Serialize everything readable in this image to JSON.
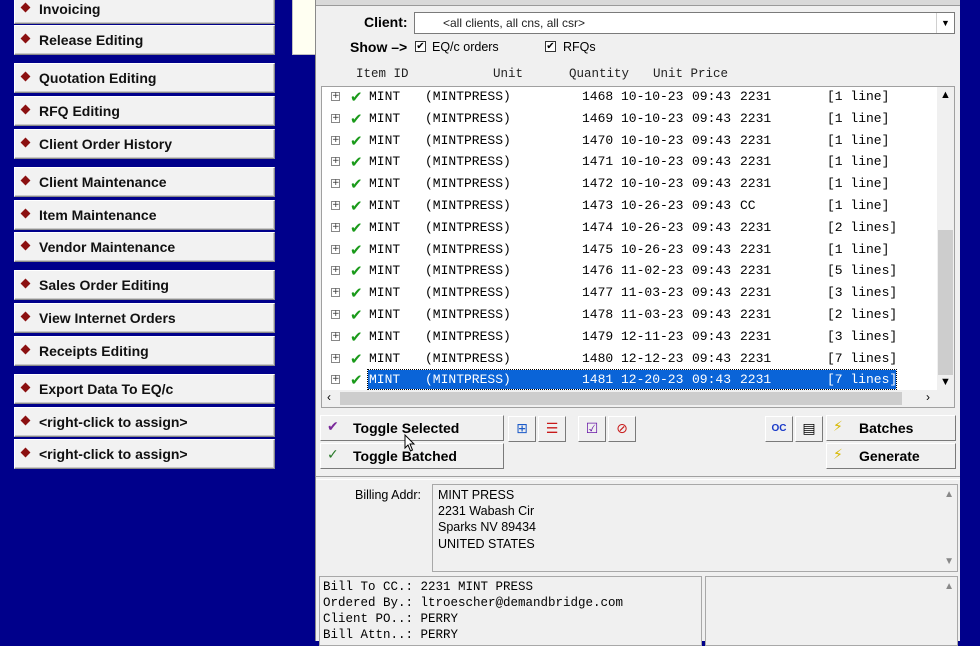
{
  "sidebar": {
    "buttons": [
      {
        "label": "Invoicing"
      },
      {
        "label": "Release Editing"
      },
      {
        "label": "Quotation Editing"
      },
      {
        "label": "RFQ Editing"
      },
      {
        "label": "Client Order History"
      },
      {
        "label": "Client Maintenance"
      },
      {
        "label": "Item Maintenance"
      },
      {
        "label": "Vendor Maintenance"
      },
      {
        "label": "Sales Order Editing"
      },
      {
        "label": "View Internet Orders"
      },
      {
        "label": "Receipts Editing"
      },
      {
        "label": "Export Data To EQ/c"
      },
      {
        "label": "<right-click to assign>"
      },
      {
        "label": "<right-click to assign>"
      }
    ]
  },
  "filter": {
    "client_label": "Client:",
    "client_value": "<all clients, all cns, all csr>",
    "show_label": "Show –>",
    "eqc_orders_label": "EQ/c orders",
    "eqc_orders_checked": true,
    "rfqs_label": "RFQs",
    "rfqs_checked": true
  },
  "columns": {
    "item_id": "Item ID",
    "unit": "Unit",
    "quantity": "Quantity",
    "unit_price": "Unit Price"
  },
  "rows": [
    {
      "item": "MINT",
      "unit": "(MINTPRESS)",
      "qty": "1468",
      "date": "10-10-23",
      "time": "09:43",
      "price": "2231",
      "lines": "[1 line]"
    },
    {
      "item": "MINT",
      "unit": "(MINTPRESS)",
      "qty": "1469",
      "date": "10-10-23",
      "time": "09:43",
      "price": "2231",
      "lines": "[1 line]"
    },
    {
      "item": "MINT",
      "unit": "(MINTPRESS)",
      "qty": "1470",
      "date": "10-10-23",
      "time": "09:43",
      "price": "2231",
      "lines": "[1 line]"
    },
    {
      "item": "MINT",
      "unit": "(MINTPRESS)",
      "qty": "1471",
      "date": "10-10-23",
      "time": "09:43",
      "price": "2231",
      "lines": "[1 line]"
    },
    {
      "item": "MINT",
      "unit": "(MINTPRESS)",
      "qty": "1472",
      "date": "10-10-23",
      "time": "09:43",
      "price": "2231",
      "lines": "[1 line]"
    },
    {
      "item": "MINT",
      "unit": "(MINTPRESS)",
      "qty": "1473",
      "date": "10-26-23",
      "time": "09:43",
      "price": "CC",
      "lines": "[1 line]"
    },
    {
      "item": "MINT",
      "unit": "(MINTPRESS)",
      "qty": "1474",
      "date": "10-26-23",
      "time": "09:43",
      "price": "2231",
      "lines": "[2 lines]"
    },
    {
      "item": "MINT",
      "unit": "(MINTPRESS)",
      "qty": "1475",
      "date": "10-26-23",
      "time": "09:43",
      "price": "2231",
      "lines": "[1 line]"
    },
    {
      "item": "MINT",
      "unit": "(MINTPRESS)",
      "qty": "1476",
      "date": "11-02-23",
      "time": "09:43",
      "price": "2231",
      "lines": "[5 lines]"
    },
    {
      "item": "MINT",
      "unit": "(MINTPRESS)",
      "qty": "1477",
      "date": "11-03-23",
      "time": "09:43",
      "price": "2231",
      "lines": "[3 lines]"
    },
    {
      "item": "MINT",
      "unit": "(MINTPRESS)",
      "qty": "1478",
      "date": "11-03-23",
      "time": "09:43",
      "price": "2231",
      "lines": "[2 lines]"
    },
    {
      "item": "MINT",
      "unit": "(MINTPRESS)",
      "qty": "1479",
      "date": "12-11-23",
      "time": "09:43",
      "price": "2231",
      "lines": "[3 lines]"
    },
    {
      "item": "MINT",
      "unit": "(MINTPRESS)",
      "qty": "1480",
      "date": "12-12-23",
      "time": "09:43",
      "price": "2231",
      "lines": "[7 lines]"
    },
    {
      "item": "MINT",
      "unit": "(MINTPRESS)",
      "qty": "1481",
      "date": "12-20-23",
      "time": "09:43",
      "price": "2231",
      "lines": "[7 lines]",
      "selected": true
    }
  ],
  "toolbar": {
    "toggle_selected": "Toggle Selected",
    "toggle_batched": "Toggle Batched",
    "batches": "Batches",
    "generate": "Generate",
    "oc_label": "OC"
  },
  "billing": {
    "label": "Billing Addr:",
    "lines": [
      "MINT PRESS",
      "2231 Wabash Cir",
      "Sparks  NV  89434",
      "UNITED STATES"
    ]
  },
  "details": {
    "lines": [
      "Bill To CC.: 2231         MINT PRESS",
      "Ordered By.: ltroescher@demandbridge.com",
      "Client PO..: PERRY",
      "Bill Attn..: PERRY"
    ]
  },
  "colors": {
    "background": "#00008b",
    "selection": "#0a64d8",
    "check": "#1a9a1a",
    "diamond": "#8b1010"
  }
}
